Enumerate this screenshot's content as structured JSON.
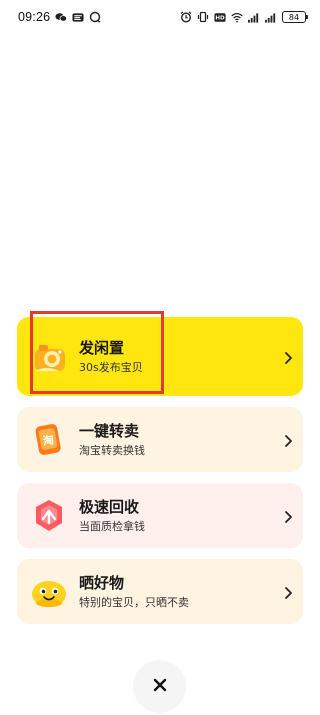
{
  "status_bar": {
    "time": "09:26",
    "battery": "84",
    "left_icons": [
      "wechat-icon",
      "weibo-icon",
      "chat-bubble-icon"
    ],
    "right_icons": [
      "alarm-icon",
      "vibrate-icon",
      "hd-icon",
      "wifi-icon",
      "signal-icon",
      "signal-icon",
      "battery-icon"
    ]
  },
  "cards": [
    {
      "title": "发闲置",
      "subtitle": "30s发布宝贝",
      "icon": "camera-icon",
      "background": "#ffe60f"
    },
    {
      "title": "一键转卖",
      "subtitle": "淘宝转卖换钱",
      "icon": "taobao-icon",
      "icon_glyph": "淘",
      "background": "#fff3e2"
    },
    {
      "title": "极速回收",
      "subtitle": "当面质检拿钱",
      "icon": "recycle-icon",
      "background": "#ffefed"
    },
    {
      "title": "晒好物",
      "subtitle": "特别的宝贝，只晒不卖",
      "icon": "smile-mascot-icon",
      "background": "#fff3e2"
    }
  ],
  "close_button": {
    "icon": "close-icon",
    "glyph": "✕"
  },
  "accent_colors": {
    "yellow": "#ffe60f",
    "highlight_red": "#e53935"
  }
}
